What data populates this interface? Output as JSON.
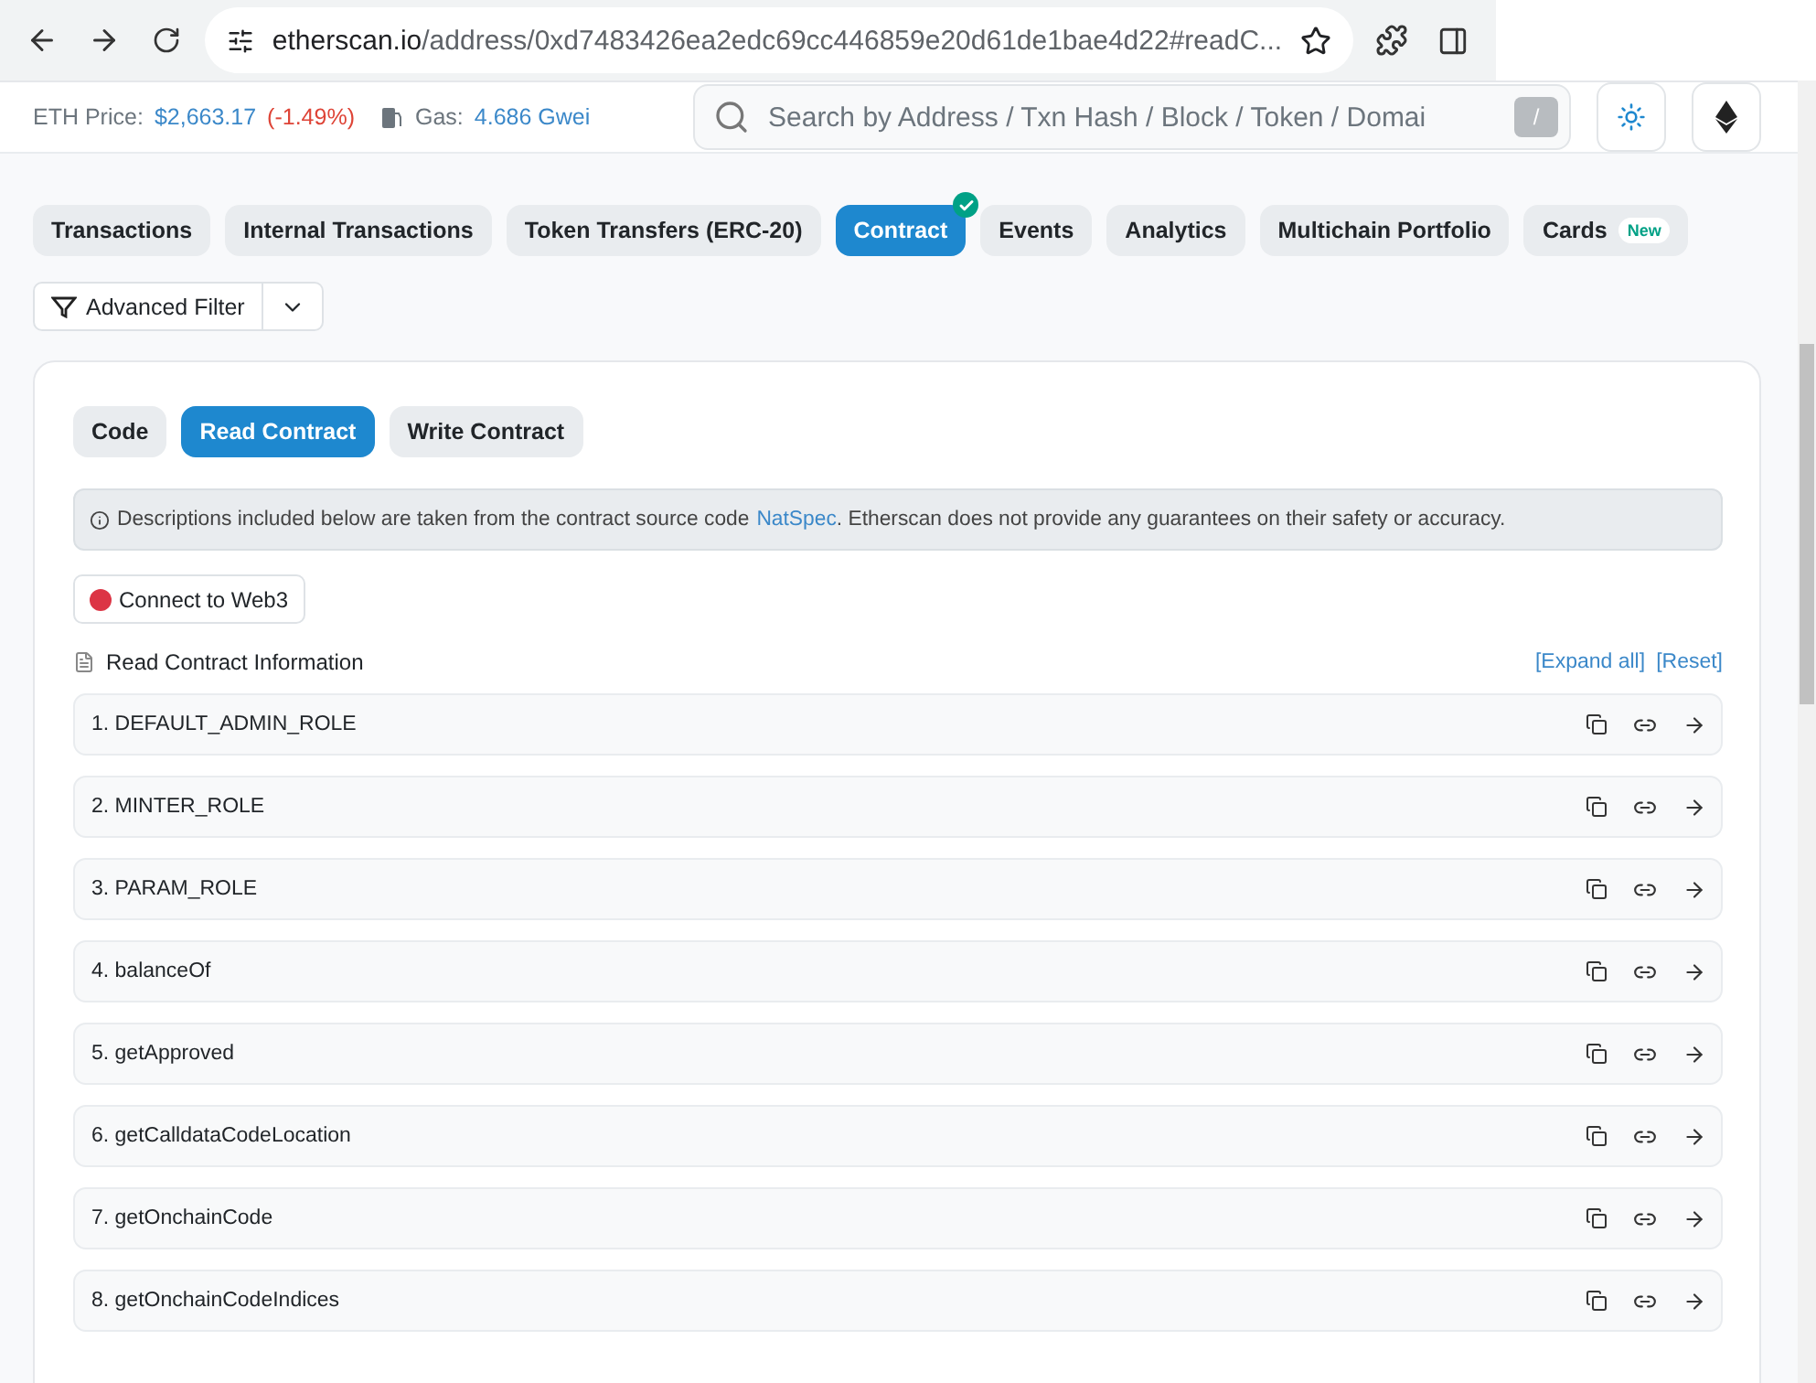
{
  "browser": {
    "url_host": "etherscan.io",
    "url_path": "/address/0xd7483426ea2edc69cc446859e20d61de1bae4d22#readC..."
  },
  "header": {
    "price_label": "ETH Price:",
    "price": "$2,663.17",
    "change": "(-1.49%)",
    "gas_label": "Gas:",
    "gas": "4.686 Gwei",
    "search_placeholder": "Search by Address / Txn Hash / Block / Token / Domai",
    "slash_key": "/"
  },
  "tabs": [
    {
      "label": "Transactions",
      "selected": false
    },
    {
      "label": "Internal Transactions",
      "selected": false
    },
    {
      "label": "Token Transfers (ERC-20)",
      "selected": false
    },
    {
      "label": "Contract",
      "selected": true,
      "verified": true
    },
    {
      "label": "Events",
      "selected": false
    },
    {
      "label": "Analytics",
      "selected": false
    },
    {
      "label": "Multichain Portfolio",
      "selected": false
    },
    {
      "label": "Cards",
      "selected": false,
      "badge": "New"
    }
  ],
  "filter_button": "Advanced Filter",
  "subtabs": [
    {
      "label": "Code",
      "selected": false
    },
    {
      "label": "Read Contract",
      "selected": true
    },
    {
      "label": "Write Contract",
      "selected": false
    }
  ],
  "notice": {
    "before": "Descriptions included below are taken from the contract source code",
    "link": "NatSpec",
    "after": ". Etherscan does not provide any guarantees on their safety or accuracy."
  },
  "connect": {
    "label": "Connect to Web3",
    "connected": false
  },
  "section_title": "Read Contract Information",
  "links": [
    "[Expand all]",
    "[Reset]"
  ],
  "functions": [
    "1. DEFAULT_ADMIN_ROLE",
    "2. MINTER_ROLE",
    "3. PARAM_ROLE",
    "4. balanceOf",
    "5. getApproved",
    "6. getCalldataCodeLocation",
    "7. getOnchainCode",
    "8. getOnchainCodeIndices"
  ]
}
